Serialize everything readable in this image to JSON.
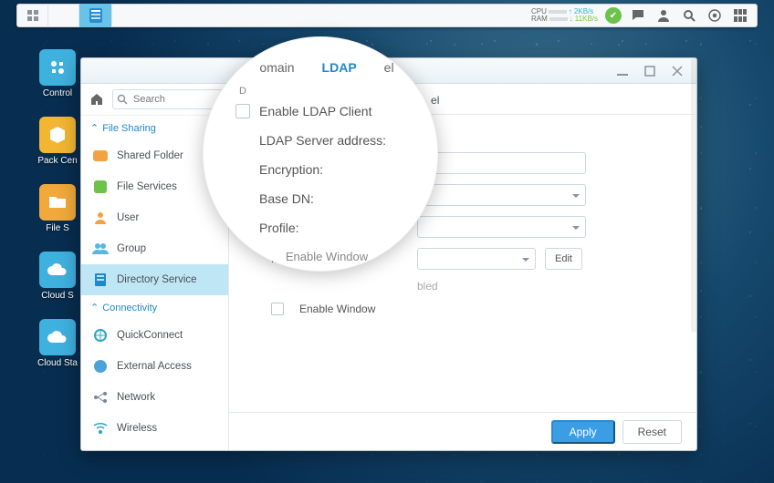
{
  "taskbar": {
    "cpu_label": "CPU",
    "ram_label": "RAM",
    "up_speed": "2KB/s",
    "down_speed": "11KB/s"
  },
  "desktop": [
    {
      "label": "Control",
      "color": "#3fb1df"
    },
    {
      "label": "Pack\nCen",
      "color": "#f2b632"
    },
    {
      "label": "File S",
      "color": "#f2a93b"
    },
    {
      "label": "Cloud S",
      "color": "#3fb1df"
    },
    {
      "label": "Cloud Sta",
      "color": "#3fb1df"
    }
  ],
  "window": {
    "search_placeholder": "Search"
  },
  "sidebar": {
    "sections": [
      {
        "title": "File Sharing",
        "items": [
          {
            "label": "Shared Folder",
            "icon": "folder",
            "color": "#f2a340"
          },
          {
            "label": "File Services",
            "icon": "services",
            "color": "#6cc24a"
          },
          {
            "label": "User",
            "icon": "user",
            "color": "#f2a340"
          },
          {
            "label": "Group",
            "icon": "group",
            "color": "#57b7e0"
          },
          {
            "label": "Directory Service",
            "icon": "dir",
            "color": "#1f89c9",
            "selected": true
          }
        ]
      },
      {
        "title": "Connectivity",
        "items": [
          {
            "label": "QuickConnect",
            "icon": "qc",
            "color": "#2aa7c9"
          },
          {
            "label": "External Access",
            "icon": "globe",
            "color": "#4aa3d8"
          },
          {
            "label": "Network",
            "icon": "net",
            "color": "#7a8690"
          },
          {
            "label": "Wireless",
            "icon": "wifi",
            "color": "#2aa7c9"
          }
        ]
      }
    ]
  },
  "tabs": {
    "domain": "omain",
    "ldap": "LDAP",
    "other": "el"
  },
  "form": {
    "enable": "Enable LDAP Client",
    "server": "LDAP Server address:",
    "encryption": "Encryption:",
    "basedn": "Base DN:",
    "profile": "Profile:",
    "edit": "Edit",
    "enable_win": "Enable Window",
    "disabled_hint": "bled"
  },
  "footer": {
    "apply": "Apply",
    "reset": "Reset"
  },
  "magnifier": {
    "tab_domain": "omain",
    "tab_ldap": "LDAP",
    "tab_other": "el",
    "row_desc": "D",
    "enable": "Enable LDAP Client",
    "server": "LDAP Server address:",
    "encryption": "Encryption:",
    "basedn": "Base DN:",
    "profile": "Profile:",
    "enable_win": "Enable Window"
  }
}
